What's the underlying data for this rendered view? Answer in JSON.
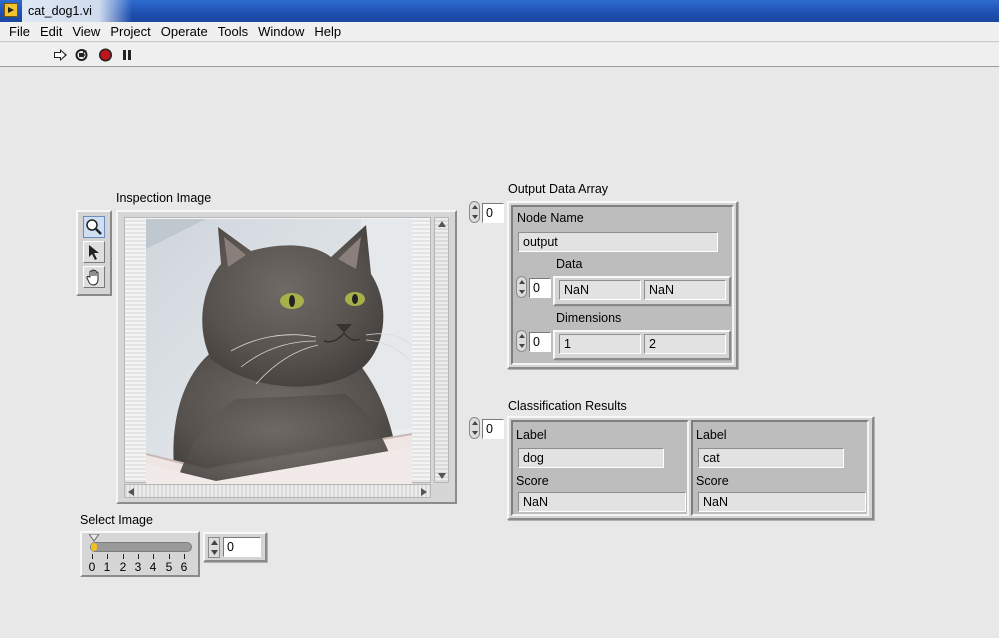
{
  "window": {
    "title": "cat_dog1.vi"
  },
  "menu": [
    "File",
    "Edit",
    "View",
    "Project",
    "Operate",
    "Tools",
    "Window",
    "Help"
  ],
  "toolbar": {
    "icons": [
      "run-arrow-icon",
      "run-continuously-icon",
      "abort-stop-icon",
      "pause-icon"
    ]
  },
  "inspection_image": {
    "label": "Inspection Image",
    "tools": [
      "zoom-icon",
      "pointer-icon",
      "pan-hand-icon"
    ],
    "image_subject": "gray cat photo"
  },
  "select_image": {
    "label": "Select Image",
    "value": "0",
    "slider_value": 0,
    "ticks": [
      "0",
      "1",
      "2",
      "3",
      "4",
      "5",
      "6"
    ],
    "slider_range": [
      0,
      6
    ]
  },
  "output_data_array": {
    "label": "Output Data Array",
    "index": "0",
    "node_name_label": "Node Name",
    "node_name_value": "output",
    "data_label": "Data",
    "data_index": "0",
    "data_values": [
      "NaN",
      "NaN"
    ],
    "dimensions_label": "Dimensions",
    "dimensions_index": "0",
    "dimensions_values": [
      "1",
      "2"
    ]
  },
  "classification_results": {
    "label": "Classification Results",
    "index": "0",
    "entries": [
      {
        "label_caption": "Label",
        "label_value": "dog",
        "score_caption": "Score",
        "score_value": "NaN"
      },
      {
        "label_caption": "Label",
        "label_value": "cat",
        "score_caption": "Score",
        "score_value": "NaN"
      }
    ]
  },
  "colors": {
    "panel_bg": "#e8e8e8",
    "title_bar": "#1d4fb0",
    "slider_fill": "#f4c020",
    "stop_button": "#c0141c"
  }
}
